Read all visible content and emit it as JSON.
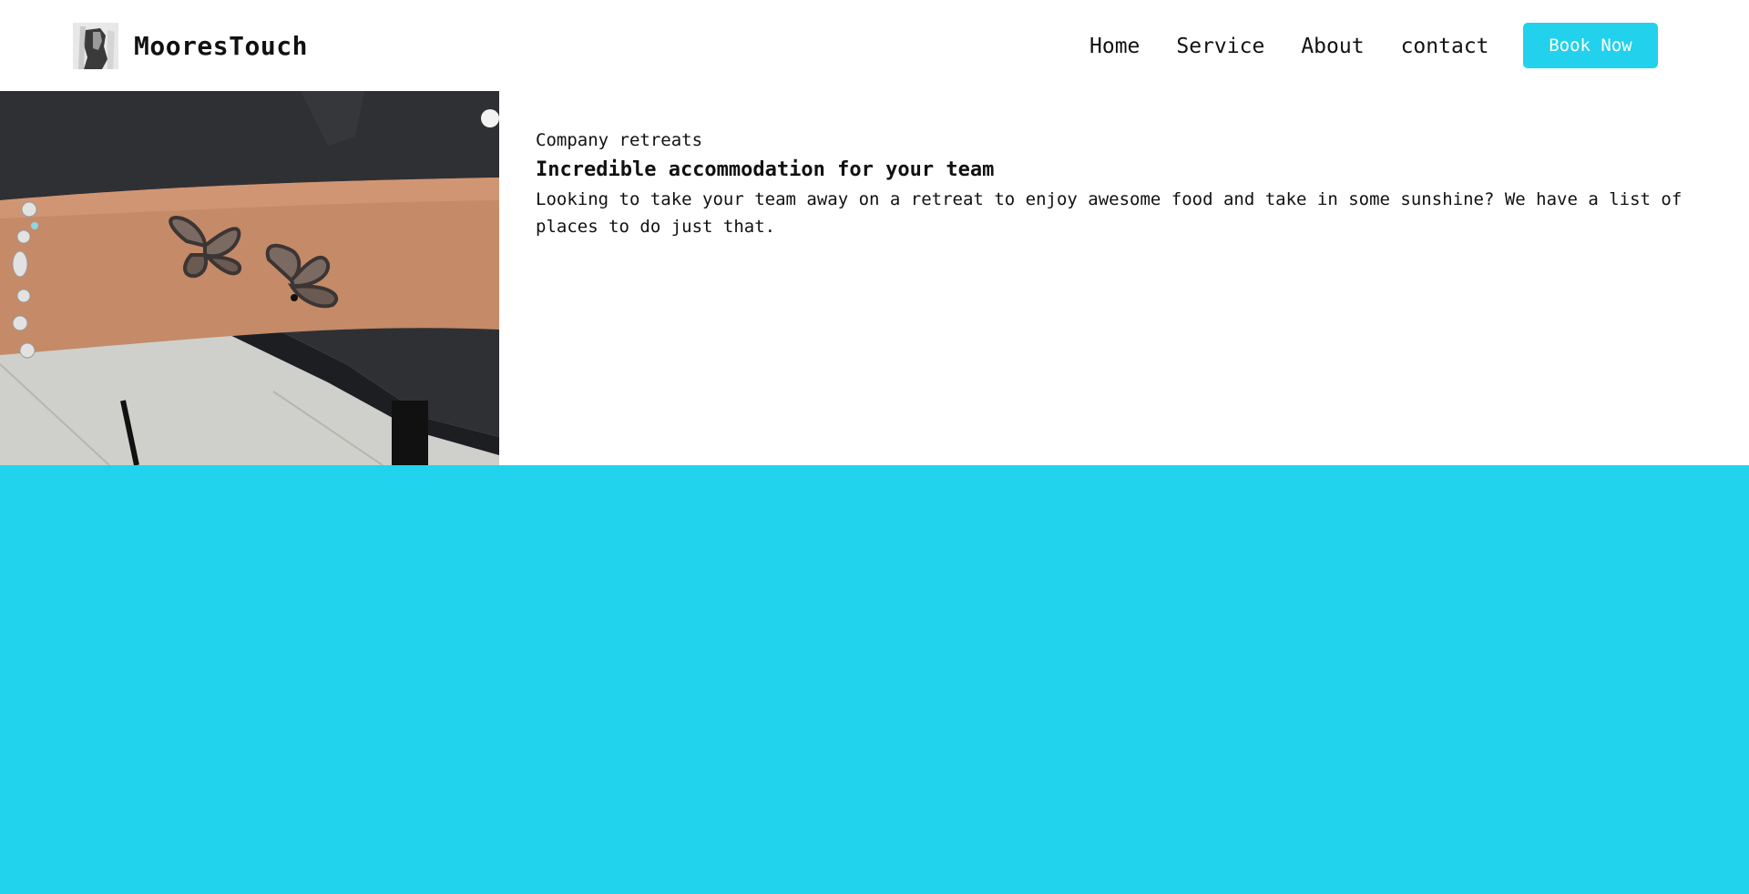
{
  "brand": {
    "name": "MooresTouch",
    "logo_icon": "portrait-logo-icon"
  },
  "nav": {
    "items": [
      {
        "label": "Home"
      },
      {
        "label": "Service"
      },
      {
        "label": "About"
      },
      {
        "label": "contact"
      }
    ],
    "cta_label": "Book Now"
  },
  "hero": {
    "image_icon": "tattoo-photo",
    "eyebrow": "Company retreats",
    "headline": "Incredible accommodation for your team",
    "description": "Looking to take your team away on a retreat to enjoy awesome food and take in some sunshine? We have a list of places to do just that."
  },
  "colors": {
    "accent": "#22d1ec",
    "band": "#22d3ed",
    "background": "#ffffff",
    "text": "#111111"
  }
}
